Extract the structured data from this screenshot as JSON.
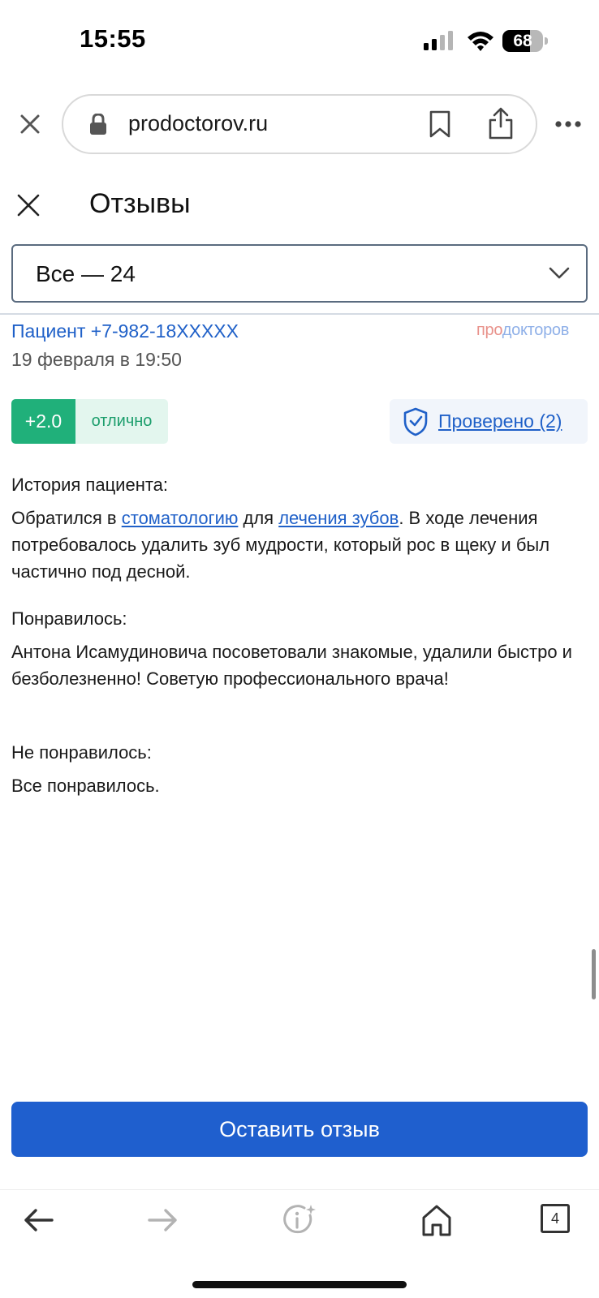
{
  "status_bar": {
    "time": "15:55",
    "battery_level": 68,
    "battery_text": "68"
  },
  "browser": {
    "url": "prodoctorov.ru",
    "icons": [
      "close-icon",
      "lock-icon",
      "bookmark-icon",
      "share-icon",
      "more-icon"
    ]
  },
  "reviews_header": {
    "title": "Отзывы"
  },
  "filter": {
    "selected": "Все — 24"
  },
  "review": {
    "author": "Пациент +7-982-18XXXXX",
    "brand_part1": "про",
    "brand_part2": "докторов",
    "date": "19 февраля в 19:50",
    "rating_score": "+2.0",
    "rating_label": "отлично",
    "verified_label": "Проверено (2)",
    "history_title": "История пациента:",
    "history_part1": "Обратился в ",
    "history_link1": "стоматологию",
    "history_part2": " для ",
    "history_link2": "лечения зубов",
    "history_part3": ". В ходе лечения потребовалось удалить зуб мудрости, который рос в щеку и был частично под десной.",
    "liked_title": "Понравилось:",
    "liked_text": "Антона Исамудиновича посоветовали знакомые, удалили быстро и безболезненно! Советую профессионального врача!",
    "disliked_title": "Не понравилось:",
    "disliked_text": "Все понравилось."
  },
  "cta": {
    "label": "Оставить отзыв"
  },
  "toolbar": {
    "tabs_count": "4",
    "icons": [
      "back-arrow-icon",
      "forward-arrow-icon",
      "info-icon",
      "home-icon",
      "tabs-icon"
    ]
  },
  "colors": {
    "accent": "#1f5fce",
    "link": "#1f60c8",
    "rating_green": "#20b07a"
  }
}
